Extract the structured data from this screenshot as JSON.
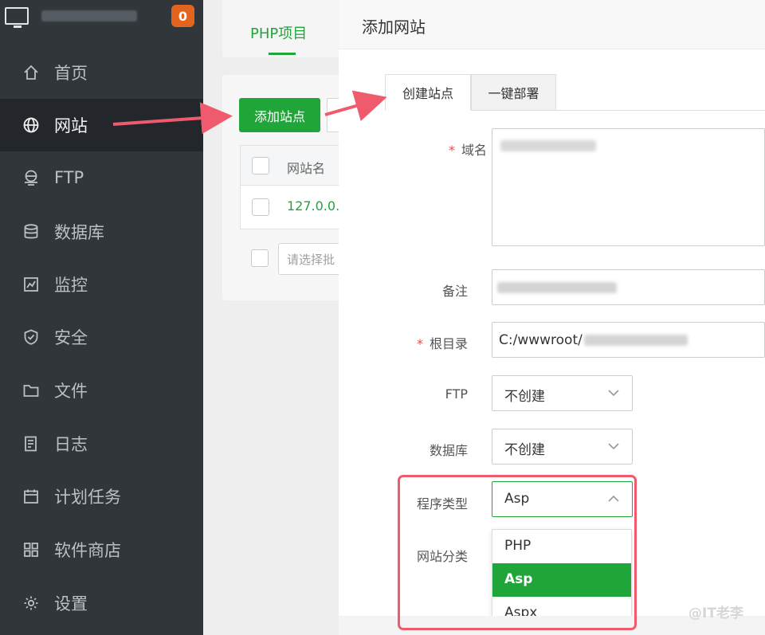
{
  "sidebar": {
    "notification_count": "0",
    "items": [
      {
        "label": "首页",
        "icon": "home-icon"
      },
      {
        "label": "网站",
        "icon": "globe-icon"
      },
      {
        "label": "FTP",
        "icon": "ftp-icon"
      },
      {
        "label": "数据库",
        "icon": "database-icon"
      },
      {
        "label": "监控",
        "icon": "monitor-chart-icon"
      },
      {
        "label": "安全",
        "icon": "shield-icon"
      },
      {
        "label": "文件",
        "icon": "folder-icon"
      },
      {
        "label": "日志",
        "icon": "log-icon"
      },
      {
        "label": "计划任务",
        "icon": "calendar-icon"
      },
      {
        "label": "软件商店",
        "icon": "apps-grid-icon"
      },
      {
        "label": "设置",
        "icon": "gear-icon"
      }
    ],
    "active_index": 1
  },
  "main": {
    "tab_label": "PHP项目",
    "add_site_label": "添加站点",
    "table": {
      "col_name": "网站名",
      "row_value": "127.0.0."
    },
    "batch_placeholder": "请选择批"
  },
  "modal": {
    "title": "添加网站",
    "tabs": [
      "创建站点",
      "一键部署"
    ],
    "fields": {
      "domain_label": "域名",
      "remark_label": "备注",
      "root_label": "根目录",
      "root_value": "C:/wwwroot/",
      "ftp_label": "FTP",
      "ftp_value": "不创建",
      "db_label": "数据库",
      "db_value": "不创建",
      "program_label": "程序类型",
      "program_value": "Asp",
      "category_label": "网站分类"
    },
    "program_options": [
      "PHP",
      "Asp",
      "Aspx"
    ],
    "program_selected_index": 1
  },
  "watermark": "@IT老李",
  "colors": {
    "accent": "#20a53a",
    "sidebar_bg": "#31363b",
    "annotation_red": "#f05a6d",
    "badge_orange": "#e2641f"
  }
}
